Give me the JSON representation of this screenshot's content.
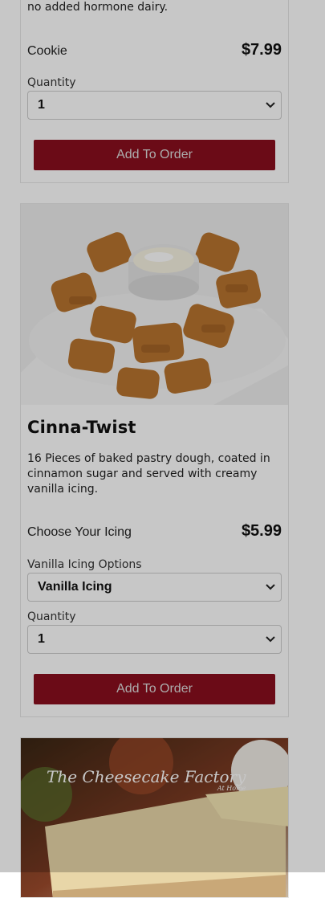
{
  "card1": {
    "desc_tail": "no added hormone dairy.",
    "option_label": "Cookie",
    "price": "$7.99",
    "quantity_label": "Quantity",
    "quantity_value": "1",
    "add_button": "Add To Order"
  },
  "card2": {
    "image_icon": "cinna-twist-photo",
    "title": "Cinna-Twist",
    "description": "16 Pieces of baked pastry dough, coated in cinnamon sugar and served with creamy vanilla icing.",
    "option_label": "Choose Your Icing",
    "price": "$5.99",
    "icing_label": "Vanilla Icing Options",
    "icing_value": "Vanilla Icing",
    "quantity_label": "Quantity",
    "quantity_value": "1",
    "add_button": "Add To Order"
  },
  "card3": {
    "logo_text": "The Cheesecake Factory",
    "logo_sub": "At Home"
  },
  "colors": {
    "button": "#8a0f1e",
    "overlay": "rgba(0,0,0,0.22)"
  }
}
